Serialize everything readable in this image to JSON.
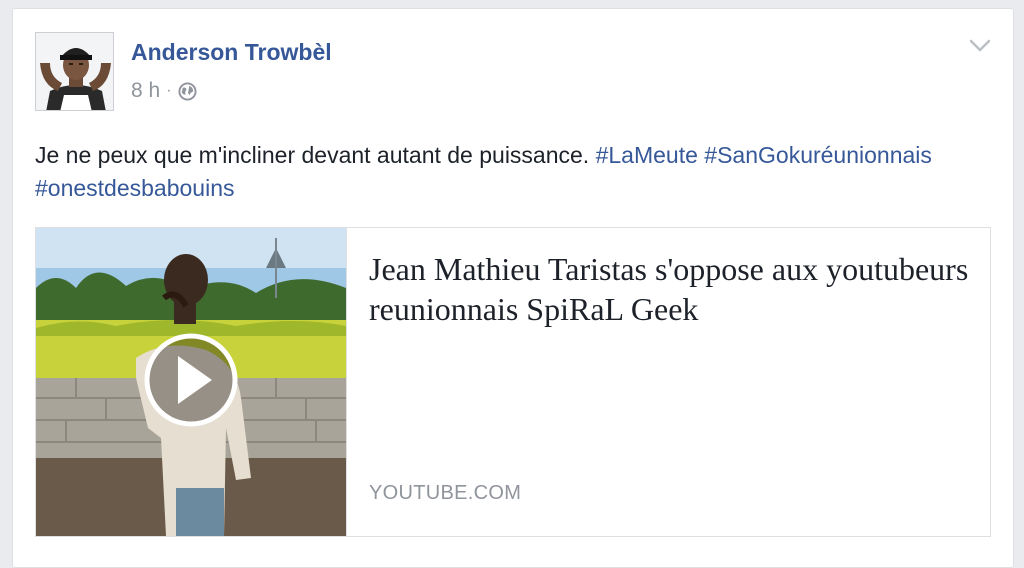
{
  "post": {
    "author": {
      "name": "Anderson Trowbèl",
      "avatar_icon": "profile-photo"
    },
    "timestamp": "8 h",
    "separator": "·",
    "audience_icon": "globe-icon",
    "menu_icon": "chevron-down-icon",
    "text": {
      "body": "Je ne peux que m'incliner devant autant de puissance.",
      "hashtags": [
        "#LaMeute",
        "#SanGokuréunionnais",
        "#onestdesbabouins"
      ]
    },
    "link_preview": {
      "title": "Jean Mathieu Taristas s'oppose aux youtubeurs reunionnais SpiRaL Geek",
      "domain": "YOUTUBE.COM",
      "play_icon": "play-icon"
    }
  },
  "colors": {
    "background": "#e9ebee",
    "link": "#365899",
    "text": "#1d2129",
    "muted": "#90949c",
    "border": "#dddfe2"
  }
}
